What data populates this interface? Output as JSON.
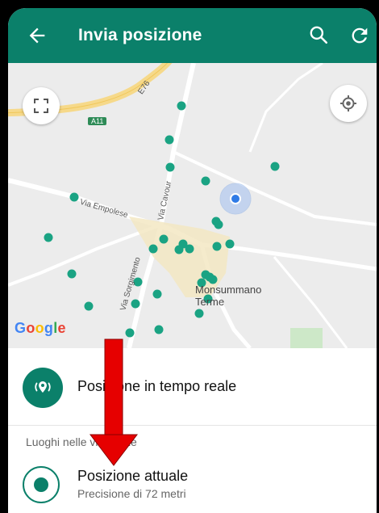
{
  "appbar": {
    "title": "Invia posizione",
    "color": "#0b806a"
  },
  "map": {
    "street_labels": {
      "a11": "A11",
      "via_empolese": "Via Empolese",
      "via_cavour": "Via Cavour",
      "via_sorgimento": "Via Sorgimento",
      "e76": "E76"
    },
    "town": "Monsummano\nTerme",
    "google_logo": "Google",
    "marker_color": "#1aa383",
    "current_location_color": "#2f7be6"
  },
  "sheet": {
    "live_location_label": "Posizione in tempo reale",
    "section_label": "Luoghi nelle vicinanze",
    "current_location_title": "Posizione attuale",
    "current_location_subtitle": "Precisione di 72 metri"
  },
  "annotation": {
    "arrow_color": "#e60000"
  }
}
